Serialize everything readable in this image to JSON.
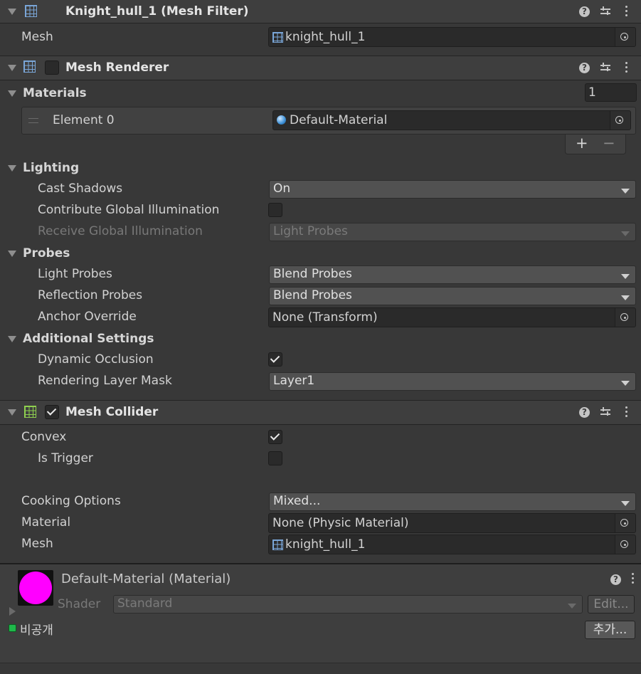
{
  "mesh_filter": {
    "title": "Knight_hull_1 (Mesh Filter)",
    "mesh_label": "Mesh",
    "mesh_value": "knight_hull_1"
  },
  "mesh_renderer": {
    "title": "Mesh Renderer",
    "enabled": false,
    "materials": {
      "label": "Materials",
      "size": "1",
      "element_label": "Element 0",
      "element_value": "Default-Material",
      "add": "+",
      "remove": "−"
    },
    "lighting": {
      "label": "Lighting",
      "cast_shadows_label": "Cast Shadows",
      "cast_shadows_value": "On",
      "contribute_gi_label": "Contribute Global Illumination",
      "contribute_gi_checked": false,
      "receive_gi_label": "Receive Global Illumination",
      "receive_gi_value": "Light Probes"
    },
    "probes": {
      "label": "Probes",
      "light_probes_label": "Light Probes",
      "light_probes_value": "Blend Probes",
      "reflection_probes_label": "Reflection Probes",
      "reflection_probes_value": "Blend Probes",
      "anchor_override_label": "Anchor Override",
      "anchor_override_value": "None (Transform)"
    },
    "additional": {
      "label": "Additional Settings",
      "dynamic_occlusion_label": "Dynamic Occlusion",
      "dynamic_occlusion_checked": true,
      "rendering_layer_mask_label": "Rendering Layer Mask",
      "rendering_layer_mask_value": "Layer1"
    }
  },
  "mesh_collider": {
    "title": "Mesh Collider",
    "enabled": true,
    "convex_label": "Convex",
    "convex_checked": true,
    "is_trigger_label": "Is Trigger",
    "is_trigger_checked": false,
    "cooking_options_label": "Cooking Options",
    "cooking_options_value": "Mixed...",
    "material_label": "Material",
    "material_value": "None (Physic Material)",
    "mesh_label": "Mesh",
    "mesh_value": "knight_hull_1"
  },
  "material_preview": {
    "title": "Default-Material (Material)",
    "shader_label": "Shader",
    "shader_value": "Standard",
    "edit_button": "Edit...",
    "private_label": "비공개",
    "add_button": "추가...",
    "swatch_color": "#ff00ff"
  },
  "colors": {
    "background": "#383838",
    "header": "#3e3e3e",
    "field": "#2a2a2a",
    "dropdown": "#515151",
    "grid_icon_blue": "#7aa6d8",
    "grid_icon_green": "#8fd14f"
  }
}
